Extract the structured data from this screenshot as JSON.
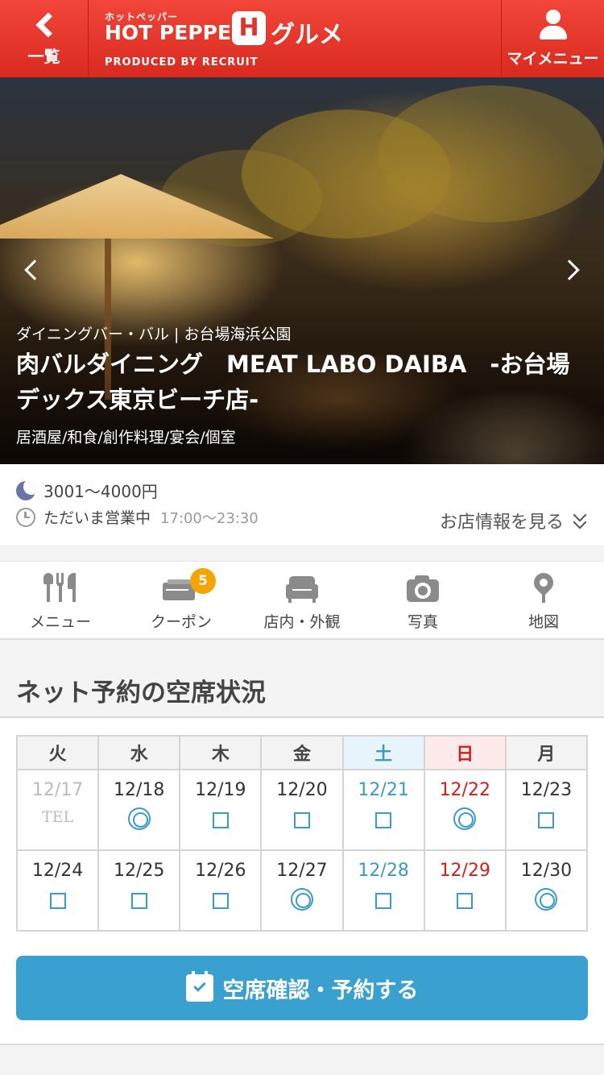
{
  "header": {
    "back_label": "一覧",
    "logo_kana": "ホットペッパー",
    "logo_main": "HOT PEPPER",
    "logo_h": "H",
    "logo_gourmet": "グルメ",
    "logo_produced": "PRODUCED BY RECRUIT",
    "my_menu_label": "マイメニュー"
  },
  "hero": {
    "genre_area": "ダイニングバー・バル | お台場海浜公園",
    "store_name": "肉バルダイニング　MEAT LABO DAIBA　-お台場デックス東京ビーチ店-",
    "categories": "居酒屋/和食/創作料理/宴会/個室"
  },
  "info": {
    "price": "3001～4000円",
    "status": "ただいま営業中",
    "hours": "17:00～23:30",
    "more_label": "お店情報を見る"
  },
  "nav": {
    "items": [
      {
        "label": "メニュー",
        "icon": "cutlery-icon"
      },
      {
        "label": "クーポン",
        "icon": "coupon-icon",
        "badge": "5"
      },
      {
        "label": "店内・外観",
        "icon": "sofa-icon"
      },
      {
        "label": "写真",
        "icon": "camera-icon"
      },
      {
        "label": "地図",
        "icon": "map-pin-icon"
      }
    ]
  },
  "reservation": {
    "section_title": "ネット予約の空席状況",
    "weekdays": [
      "火",
      "水",
      "木",
      "金",
      "土",
      "日",
      "月"
    ],
    "weeks": [
      [
        {
          "date": "12/17",
          "mark": "TEL"
        },
        {
          "date": "12/18",
          "mark": "◎"
        },
        {
          "date": "12/19",
          "mark": "□"
        },
        {
          "date": "12/20",
          "mark": "□"
        },
        {
          "date": "12/21",
          "mark": "□"
        },
        {
          "date": "12/22",
          "mark": "◎"
        },
        {
          "date": "12/23",
          "mark": "□"
        }
      ],
      [
        {
          "date": "12/24",
          "mark": "□"
        },
        {
          "date": "12/25",
          "mark": "□"
        },
        {
          "date": "12/26",
          "mark": "□"
        },
        {
          "date": "12/27",
          "mark": "◎"
        },
        {
          "date": "12/28",
          "mark": "□"
        },
        {
          "date": "12/29",
          "mark": "□"
        },
        {
          "date": "12/30",
          "mark": "◎"
        }
      ]
    ],
    "book_button_label": "空席確認・予約する"
  },
  "colors": {
    "header_red": "#e0332a",
    "accent_blue": "#3aa0cf",
    "saturday_blue": "#3a9ac9",
    "sunday_red": "#d0201a",
    "badge_orange": "#f5a300"
  }
}
